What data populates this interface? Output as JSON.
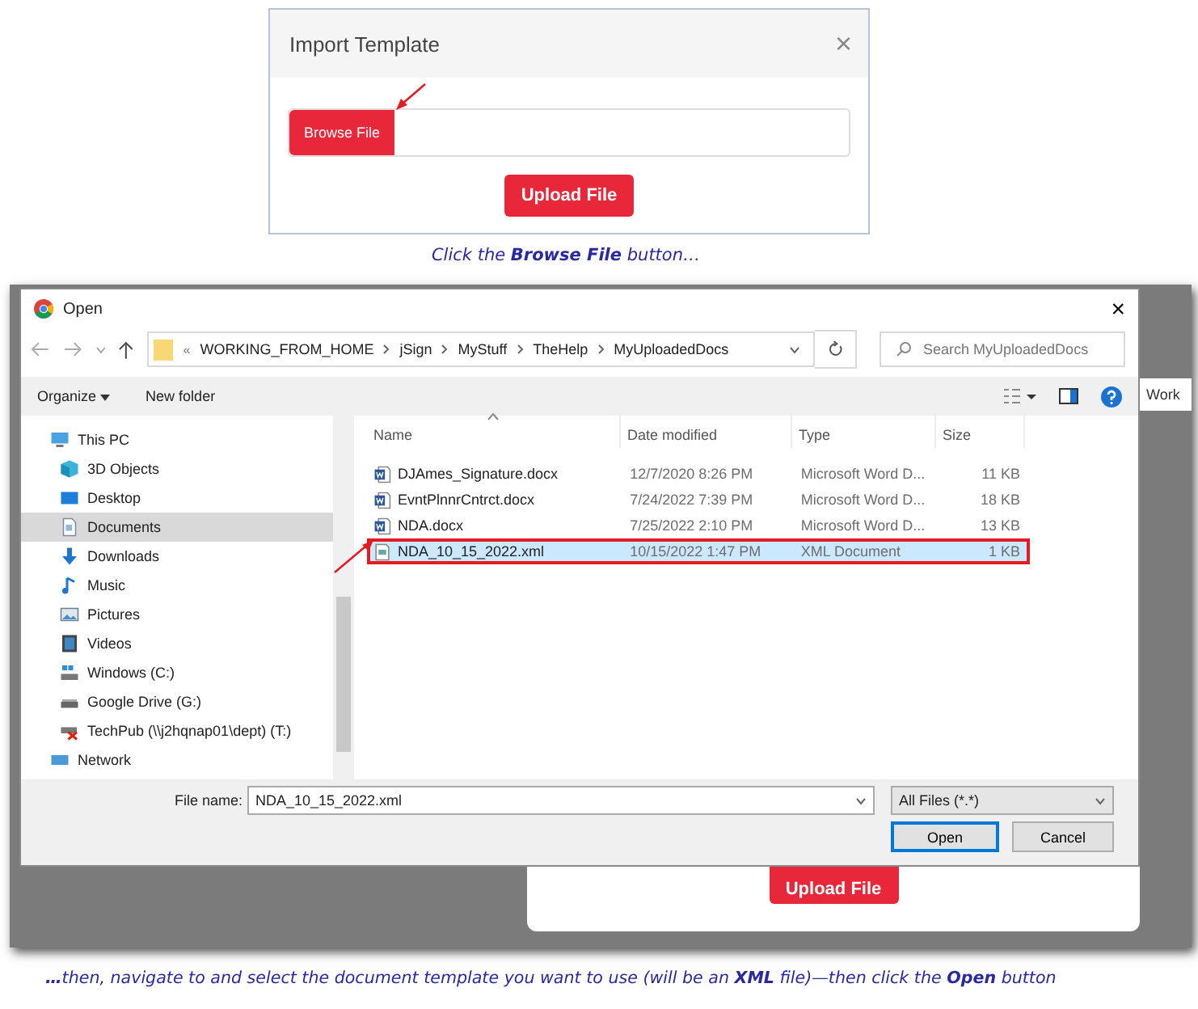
{
  "import_dialog": {
    "title": "Import Template",
    "close": "×",
    "browse_button": "Browse File",
    "upload_button": "Upload File"
  },
  "caption_1": "Click the **Browse File** button…",
  "background_app": {
    "tab_text": "Work",
    "upload_button": "Upload File"
  },
  "open_dialog": {
    "title": "Open",
    "close": "×",
    "address": {
      "prefix": "«",
      "path": [
        "WORKING_FROM_HOME",
        "jSign",
        "MyStuff",
        "TheHelp",
        "MyUploadedDocs"
      ]
    },
    "search": {
      "placeholder": "Search MyUploadedDocs"
    },
    "toolbar": {
      "organize": "Organize",
      "new_folder": "New folder"
    },
    "nav": [
      {
        "label": "This PC",
        "kind": "pc",
        "selected": false,
        "children": [
          {
            "label": "3D Objects",
            "kind": "cube",
            "selected": false
          },
          {
            "label": "Desktop",
            "kind": "desktop",
            "selected": false
          },
          {
            "label": "Documents",
            "kind": "documents",
            "selected": true
          },
          {
            "label": "Downloads",
            "kind": "downloads",
            "selected": false
          },
          {
            "label": "Music",
            "kind": "music",
            "selected": false
          },
          {
            "label": "Pictures",
            "kind": "pictures",
            "selected": false
          },
          {
            "label": "Videos",
            "kind": "videos",
            "selected": false
          },
          {
            "label": "Windows (C:)",
            "kind": "system-drive",
            "selected": false
          },
          {
            "label": "Google Drive (G:)",
            "kind": "drive",
            "selected": false
          },
          {
            "label": "TechPub (\\\\j2hqnap01\\dept) (T:)",
            "kind": "network-drive",
            "selected": false
          }
        ]
      },
      {
        "label": "Network",
        "kind": "network",
        "selected": false
      }
    ],
    "columns": [
      {
        "label": "Name",
        "sorted": true
      },
      {
        "label": "Date modified",
        "sorted": false
      },
      {
        "label": "Type",
        "sorted": false
      },
      {
        "label": "Size",
        "sorted": false
      }
    ],
    "files": [
      {
        "name": "DJAmes_Signature.docx",
        "date": "12/7/2020 8:26 PM",
        "type": "Microsoft Word D...",
        "size": "11 KB",
        "kind": "word",
        "selected": false
      },
      {
        "name": "EvntPlnnrCntrct.docx",
        "date": "7/24/2022 7:39 PM",
        "type": "Microsoft Word D...",
        "size": "18 KB",
        "kind": "word",
        "selected": false
      },
      {
        "name": "NDA.docx",
        "date": "7/25/2022 2:10 PM",
        "type": "Microsoft Word D...",
        "size": "13 KB",
        "kind": "word",
        "selected": false
      },
      {
        "name": "NDA_10_15_2022.xml",
        "date": "10/15/2022 1:47 PM",
        "type": "XML Document",
        "size": "1 KB",
        "kind": "xml",
        "selected": true
      }
    ],
    "file_name": {
      "label": "File name:",
      "value": "NDA_10_15_2022.xml"
    },
    "file_type": "All Files (*.*)",
    "buttons": [
      {
        "label": "Open",
        "default": true
      },
      {
        "label": "Cancel",
        "default": false
      }
    ]
  },
  "caption_2": "**…**then, navigate to and select the document template you want to use (will be an **XML** file)—then click the **Open** button"
}
